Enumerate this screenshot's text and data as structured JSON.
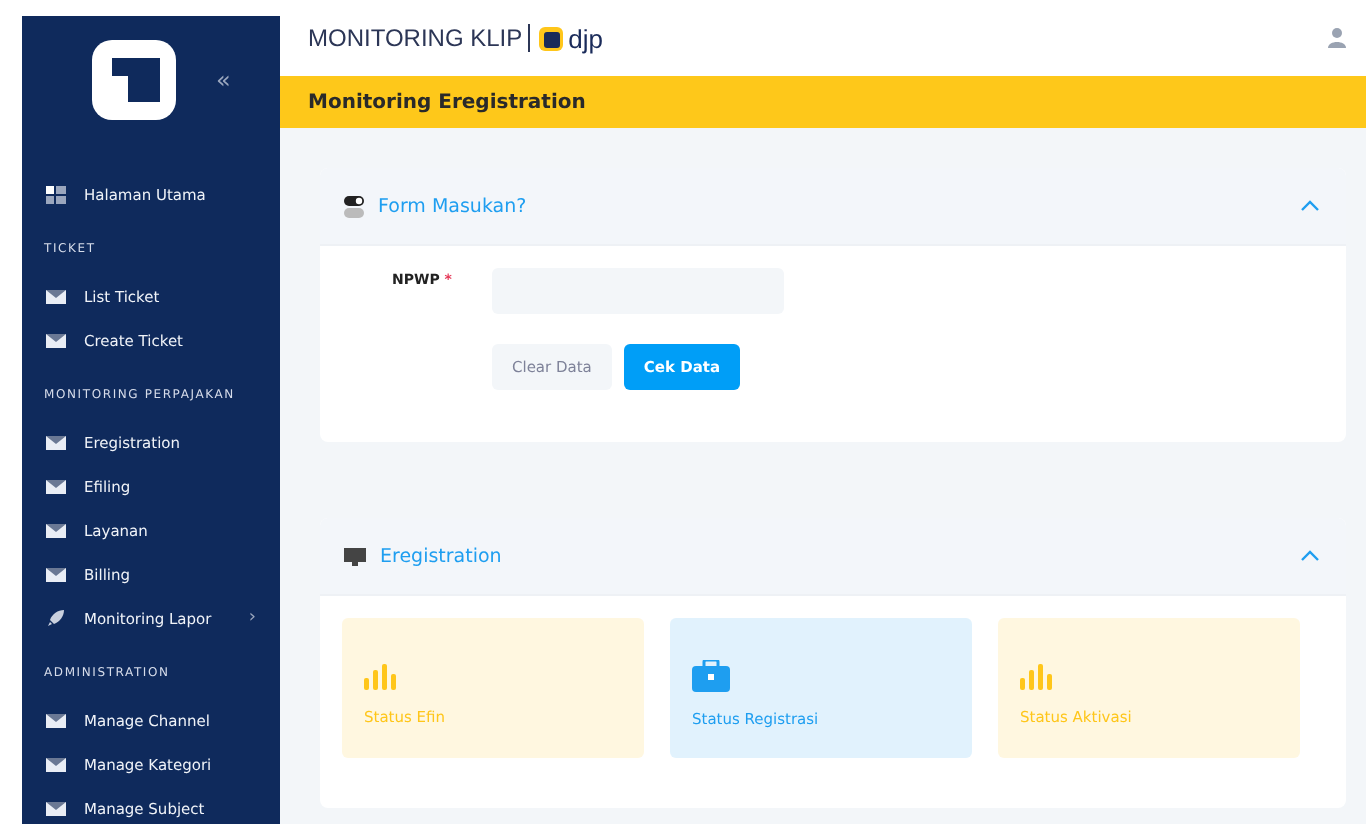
{
  "sidebar": {
    "collapse_icon": "«",
    "items": [
      {
        "label": "Halaman Utama",
        "kind": "dashboard"
      }
    ],
    "sections": [
      {
        "title": "TICKET",
        "items": [
          {
            "label": "List Ticket",
            "kind": "mail"
          },
          {
            "label": "Create Ticket",
            "kind": "mail"
          }
        ]
      },
      {
        "title": "MONITORING PERPAJAKAN",
        "items": [
          {
            "label": "Eregistration",
            "kind": "mail"
          },
          {
            "label": "Efiling",
            "kind": "mail"
          },
          {
            "label": "Layanan",
            "kind": "mail"
          },
          {
            "label": "Billing",
            "kind": "mail"
          },
          {
            "label": "Monitoring Lapor",
            "kind": "rocket",
            "submenu": "›"
          }
        ]
      },
      {
        "title": "ADMINISTRATION",
        "items": [
          {
            "label": "Manage Channel",
            "kind": "mail"
          },
          {
            "label": "Manage Kategori",
            "kind": "mail"
          },
          {
            "label": "Manage Subject",
            "kind": "mail"
          }
        ]
      }
    ]
  },
  "header": {
    "app_title": "MONITORING KLIP",
    "logo_text": "djp"
  },
  "page_title": "Monitoring Eregistration",
  "form_card": {
    "title": "Form Masukan?",
    "field": {
      "label": "NPWP",
      "required_mark": "*"
    },
    "buttons": [
      {
        "label": "Clear Data",
        "kind": "secondary"
      },
      {
        "label": "Cek Data",
        "kind": "primary"
      }
    ]
  },
  "status_card": {
    "title": "Eregistration",
    "tiles": [
      {
        "label": "Status Efin",
        "kind": "chart",
        "color": "#ffc61a"
      },
      {
        "label": "Status Registrasi",
        "kind": "briefcase",
        "color": "#1e9ef0"
      },
      {
        "label": "Status Aktivasi",
        "kind": "chart",
        "color": "#ffc61a"
      }
    ]
  }
}
